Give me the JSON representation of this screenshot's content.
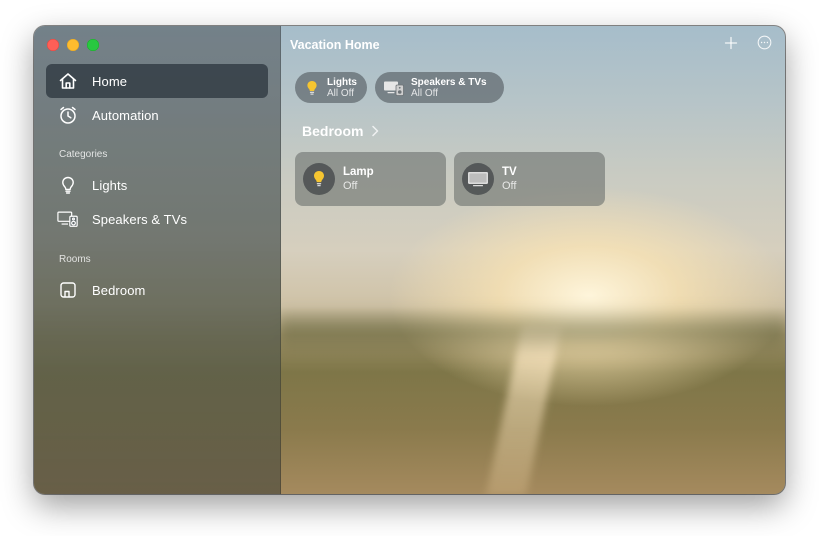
{
  "window": {
    "title": "Vacation Home"
  },
  "sidebar": {
    "items": [
      {
        "label": "Home",
        "icon": "house-icon",
        "selected": true
      },
      {
        "label": "Automation",
        "icon": "clock-icon",
        "selected": false
      }
    ],
    "categories_header": "Categories",
    "categories": [
      {
        "label": "Lights",
        "icon": "lightbulb-icon"
      },
      {
        "label": "Speakers & TVs",
        "icon": "tv-speaker-icon"
      }
    ],
    "rooms_header": "Rooms",
    "rooms": [
      {
        "label": "Bedroom",
        "icon": "room-icon"
      }
    ]
  },
  "toolbar": {
    "add_icon": "plus-icon",
    "more_icon": "ellipsis-circle-icon"
  },
  "summary_chips": [
    {
      "name": "Lights",
      "status": "All Off",
      "icon": "lightbulb-icon"
    },
    {
      "name": "Speakers & TVs",
      "status": "All Off",
      "icon": "tv-speaker-icon"
    }
  ],
  "room_section": {
    "title": "Bedroom",
    "accessories": [
      {
        "name": "Lamp",
        "status": "Off",
        "icon": "lightbulb-icon"
      },
      {
        "name": "TV",
        "status": "Off",
        "icon": "tv-icon"
      }
    ]
  },
  "colors": {
    "bulb_yellow": "#f6c531",
    "close_red": "#fe5f57",
    "minimize_yellow": "#febc2e",
    "zoom_green": "#28c840"
  }
}
